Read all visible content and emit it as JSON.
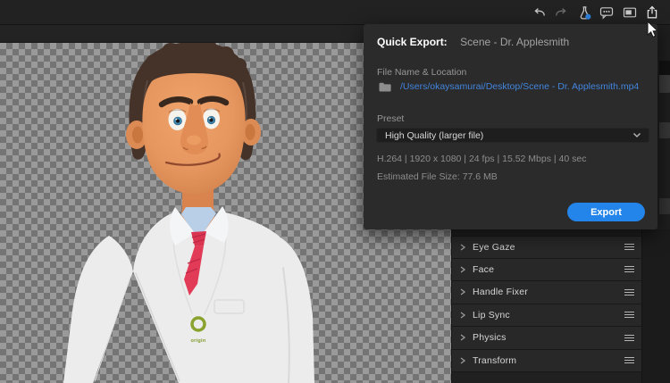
{
  "toolbar": {
    "icons": [
      {
        "name": "undo"
      },
      {
        "name": "redo"
      },
      {
        "name": "beta-flask",
        "badge_color": "#2e82e0"
      },
      {
        "name": "feedback-bubble"
      },
      {
        "name": "picture-in-picture"
      },
      {
        "name": "share-export"
      }
    ]
  },
  "quick_export": {
    "title": "Quick Export:",
    "scene_name": "Scene - Dr. Applesmith",
    "file_label": "File Name & Location",
    "file_path": "/Users/okaysamurai/Desktop/Scene - Dr. Applesmith.mp4",
    "preset_label": "Preset",
    "preset_value": "High Quality (larger file)",
    "format_info": "H.264 | 1920 x 1080 | 24 fps | 15.52 Mbps | 40 sec",
    "estimated_size": "Estimated File Size: 77.6 MB",
    "export_label": "Export"
  },
  "behaviors": {
    "items": [
      {
        "label": "Eye Gaze"
      },
      {
        "label": "Face"
      },
      {
        "label": "Handle Fixer"
      },
      {
        "label": "Lip Sync"
      },
      {
        "label": "Physics"
      },
      {
        "label": "Transform"
      }
    ]
  },
  "character": {
    "badge_text": "origin"
  },
  "colors": {
    "export_button": "#2384ea",
    "link": "#4285de",
    "flask_badge": "#2e82e0",
    "checker_light": "#9a9a9a",
    "checker_dark": "#747474"
  }
}
